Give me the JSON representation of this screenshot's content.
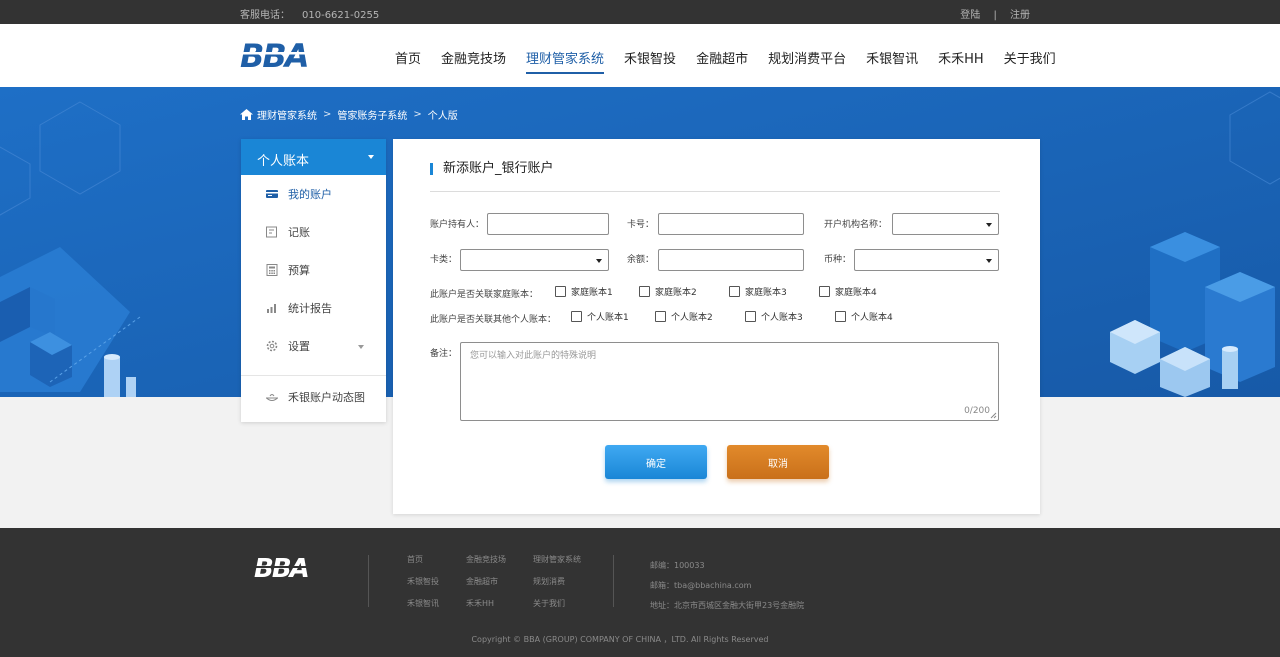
{
  "topbar": {
    "phone_label": "客服电话：",
    "phone_number": "010-6621-0255",
    "login": "登陆",
    "separator": "|",
    "register": "注册"
  },
  "header": {
    "logo_text": "BBA",
    "nav": [
      "首页",
      "金融竞技场",
      "理财管家系统",
      "禾银智投",
      "金融超市",
      "规划消费平台",
      "禾银智讯",
      "禾禾HH",
      "关于我们"
    ],
    "active_nav": "理财管家系统"
  },
  "breadcrumb": {
    "items": [
      "理财管家系统",
      "管家账务子系统",
      "个人版"
    ],
    "separator": ">"
  },
  "sidebar": {
    "title": "个人账本",
    "items": [
      {
        "label": "我的账户",
        "icon": "card-icon",
        "active": true
      },
      {
        "label": "记账",
        "icon": "notebook-icon"
      },
      {
        "label": "预算",
        "icon": "calculator-icon"
      },
      {
        "label": "统计报告",
        "icon": "chart-icon"
      },
      {
        "label": "设置",
        "icon": "gear-icon"
      }
    ],
    "extra_item": {
      "label": "禾银账户动态图",
      "icon": "dish-icon"
    }
  },
  "form": {
    "title": "新添账户_银行账户",
    "holder_label": "账户持有人：",
    "card_no_label": "卡号：",
    "institution_label": "开户机构名称：",
    "card_type_label": "卡类：",
    "balance_label": "余额：",
    "currency_label": "币种：",
    "family_link_label": "此账户是否关联家庭账本：",
    "family_books": [
      "家庭账本1",
      "家庭账本2",
      "家庭账本3",
      "家庭账本4"
    ],
    "personal_link_label": "此账户是否关联其他个人账本：",
    "personal_books": [
      "个人账本1",
      "个人账本2",
      "个人账本3",
      "个人账本4"
    ],
    "remark_label": "备注：",
    "remark_placeholder": "您可以输入对此账户的特殊说明",
    "remark_counter": "0/200",
    "confirm_button": "确定",
    "cancel_button": "取消"
  },
  "footer": {
    "logo_text": "BBA",
    "links": [
      [
        "首页",
        "金融竞技场",
        "理财管家系统"
      ],
      [
        "禾银智投",
        "金融超市",
        "规划消费"
      ],
      [
        "禾银智讯",
        "禾禾HH",
        "关于我们"
      ]
    ],
    "postcode": "邮编：100033",
    "email": "邮箱：tba@bbachina.com",
    "address": "地址：北京市西城区金融大街甲23号金融院",
    "copyright": "Copyright © BBA (GROUP) COMPANY OF CHINA ，LTD. All Rights Reserved"
  },
  "colors": {
    "brand_blue": "#1b63b8",
    "accent_blue": "#1a86d6",
    "cancel_orange": "#d27a20",
    "dark_bar": "#333333"
  }
}
